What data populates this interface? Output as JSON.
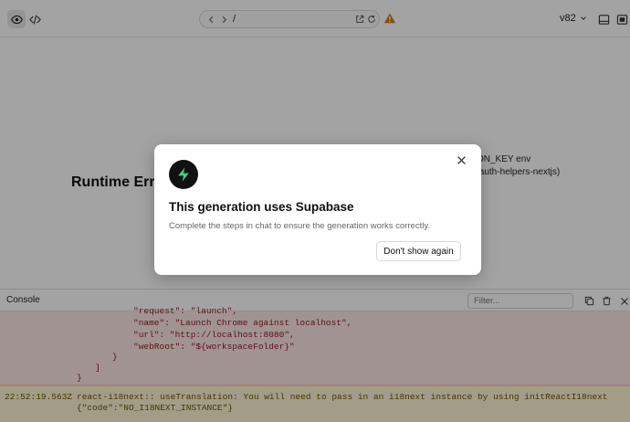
{
  "toolbar": {
    "url_path": "/",
    "version": "v82"
  },
  "preview": {
    "runtime_title": "Runtime Erro",
    "right_line_1": "ON_KEY env",
    "right_line_2": "/auth-helpers-nextjs)"
  },
  "console": {
    "title": "Console",
    "filter_placeholder": "Filter...",
    "error_lines": [
      "\"request\": \"launch\",",
      "\"name\": \"Launch Chrome against localhost\",",
      "\"url\": \"http://localhost:8080\",",
      "\"webRoot\": \"${workspaceFolder}\"",
      "}",
      "]",
      "}"
    ],
    "warning": {
      "timestamp": "22:52:19.563Z",
      "line_1": "react-i18next:: useTranslation: You will need to pass in an i18next instance by using initReactI18next",
      "line_2": "{\"code\":\"NO_I18NEXT_INSTANCE\"}"
    }
  },
  "modal": {
    "title": "This generation uses Supabase",
    "description": "Complete the steps in chat to ensure the generation works correctly.",
    "button_label": "Don't show again"
  },
  "icons": {
    "preview": "eye-icon",
    "code": "code-icon",
    "back": "chevron-left-icon",
    "forward": "chevron-right-icon",
    "open_external": "external-link-icon",
    "refresh": "refresh-icon",
    "warning": "warning-triangle-icon",
    "version_dropdown": "chevron-down-icon",
    "panel": "panel-icon",
    "fullscreen": "fullscreen-icon",
    "copy": "copy-icon",
    "trash": "trash-icon",
    "close": "close-icon",
    "logo": "supabase-logo-icon"
  },
  "colors": {
    "warning": "#d97706",
    "supabase_green": "#3ecf8e",
    "error_bg": "#fde6e6",
    "warning_bg": "#fdf6d2"
  }
}
